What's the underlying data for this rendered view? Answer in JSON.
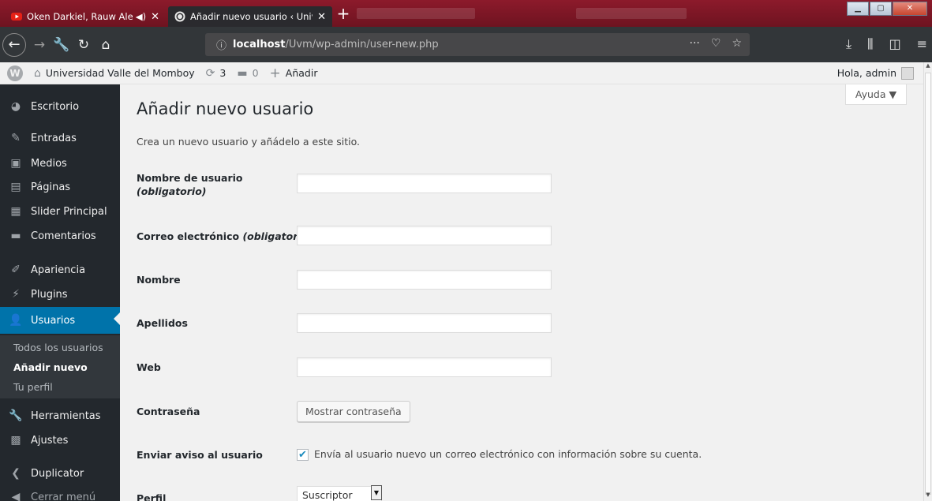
{
  "browser": {
    "tabs": [
      {
        "title": "Oken Darkiel, Rauw Alejand",
        "icon": "youtube-icon",
        "audio_icon": "speaker-icon"
      },
      {
        "title": "Añadir nuevo usuario ‹ Univers",
        "icon": "wordpress-icon",
        "active": true
      }
    ],
    "new_tab_symbol": "+",
    "close_symbol": "✕",
    "url": {
      "host": "localhost",
      "path": "/Uvm/wp-admin/user-new.php"
    }
  },
  "adminbar": {
    "site_name": "Universidad Valle del Momboy",
    "updates_count": "3",
    "comments_count": "0",
    "new_label": "Añadir",
    "greeting": "Hola, admin"
  },
  "sidebar": {
    "items": [
      {
        "label": "Escritorio",
        "icon": "dashboard-icon"
      },
      {
        "label": "Entradas",
        "icon": "pushpin-icon"
      },
      {
        "label": "Medios",
        "icon": "media-icon"
      },
      {
        "label": "Páginas",
        "icon": "pages-icon"
      },
      {
        "label": "Slider Principal",
        "icon": "slider-icon"
      },
      {
        "label": "Comentarios",
        "icon": "comments-icon"
      },
      {
        "label": "Apariencia",
        "icon": "appearance-icon"
      },
      {
        "label": "Plugins",
        "icon": "plugins-icon"
      },
      {
        "label": "Usuarios",
        "icon": "users-icon",
        "active": true
      },
      {
        "label": "Herramientas",
        "icon": "tools-icon"
      },
      {
        "label": "Ajustes",
        "icon": "settings-icon"
      },
      {
        "label": "Duplicator",
        "icon": "duplicator-icon"
      },
      {
        "label": "Cerrar menú",
        "icon": "collapse-icon"
      }
    ],
    "submenu": [
      {
        "label": "Todos los usuarios"
      },
      {
        "label": "Añadir nuevo",
        "current": true
      },
      {
        "label": "Tu perfil"
      }
    ]
  },
  "main": {
    "help_label": "Ayuda ▼",
    "title": "Añadir nuevo usuario",
    "description": "Crea un nuevo usuario y añádelo a este sitio.",
    "fields": {
      "username_label": "Nombre de usuario",
      "username_required": "(obligatorio)",
      "email_label": "Correo electrónico",
      "email_required": "(obligatorio)",
      "first_name_label": "Nombre",
      "last_name_label": "Apellidos",
      "web_label": "Web",
      "password_label": "Contraseña",
      "show_password_button": "Mostrar contraseña",
      "notify_label": "Enviar aviso al usuario",
      "notify_checkbox_text": "Envía al usuario nuevo un correo electrónico con información sobre su cuenta.",
      "notify_checked": true,
      "role_label": "Perfil",
      "role_value": "Suscriptor"
    }
  },
  "colors": {
    "sidebar_bg": "#23282d",
    "active_menu": "#0073aa",
    "content_bg": "#f1f1f1"
  }
}
